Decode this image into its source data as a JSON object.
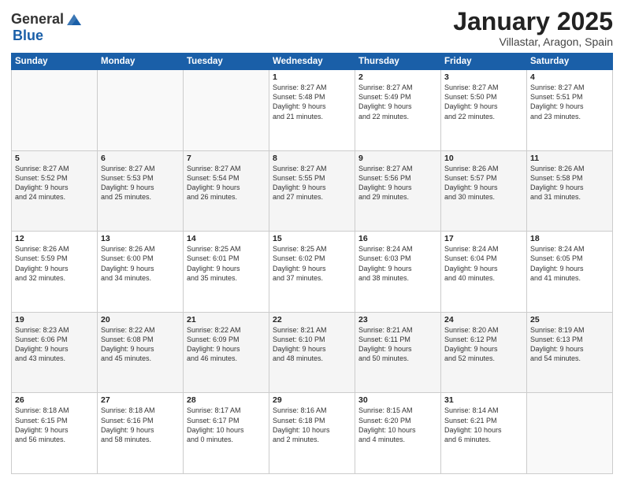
{
  "header": {
    "logo_general": "General",
    "logo_blue": "Blue",
    "month_title": "January 2025",
    "location": "Villastar, Aragon, Spain"
  },
  "weekdays": [
    "Sunday",
    "Monday",
    "Tuesday",
    "Wednesday",
    "Thursday",
    "Friday",
    "Saturday"
  ],
  "weeks": [
    [
      {
        "day": "",
        "info": ""
      },
      {
        "day": "",
        "info": ""
      },
      {
        "day": "",
        "info": ""
      },
      {
        "day": "1",
        "info": "Sunrise: 8:27 AM\nSunset: 5:48 PM\nDaylight: 9 hours\nand 21 minutes."
      },
      {
        "day": "2",
        "info": "Sunrise: 8:27 AM\nSunset: 5:49 PM\nDaylight: 9 hours\nand 22 minutes."
      },
      {
        "day": "3",
        "info": "Sunrise: 8:27 AM\nSunset: 5:50 PM\nDaylight: 9 hours\nand 22 minutes."
      },
      {
        "day": "4",
        "info": "Sunrise: 8:27 AM\nSunset: 5:51 PM\nDaylight: 9 hours\nand 23 minutes."
      }
    ],
    [
      {
        "day": "5",
        "info": "Sunrise: 8:27 AM\nSunset: 5:52 PM\nDaylight: 9 hours\nand 24 minutes."
      },
      {
        "day": "6",
        "info": "Sunrise: 8:27 AM\nSunset: 5:53 PM\nDaylight: 9 hours\nand 25 minutes."
      },
      {
        "day": "7",
        "info": "Sunrise: 8:27 AM\nSunset: 5:54 PM\nDaylight: 9 hours\nand 26 minutes."
      },
      {
        "day": "8",
        "info": "Sunrise: 8:27 AM\nSunset: 5:55 PM\nDaylight: 9 hours\nand 27 minutes."
      },
      {
        "day": "9",
        "info": "Sunrise: 8:27 AM\nSunset: 5:56 PM\nDaylight: 9 hours\nand 29 minutes."
      },
      {
        "day": "10",
        "info": "Sunrise: 8:26 AM\nSunset: 5:57 PM\nDaylight: 9 hours\nand 30 minutes."
      },
      {
        "day": "11",
        "info": "Sunrise: 8:26 AM\nSunset: 5:58 PM\nDaylight: 9 hours\nand 31 minutes."
      }
    ],
    [
      {
        "day": "12",
        "info": "Sunrise: 8:26 AM\nSunset: 5:59 PM\nDaylight: 9 hours\nand 32 minutes."
      },
      {
        "day": "13",
        "info": "Sunrise: 8:26 AM\nSunset: 6:00 PM\nDaylight: 9 hours\nand 34 minutes."
      },
      {
        "day": "14",
        "info": "Sunrise: 8:25 AM\nSunset: 6:01 PM\nDaylight: 9 hours\nand 35 minutes."
      },
      {
        "day": "15",
        "info": "Sunrise: 8:25 AM\nSunset: 6:02 PM\nDaylight: 9 hours\nand 37 minutes."
      },
      {
        "day": "16",
        "info": "Sunrise: 8:24 AM\nSunset: 6:03 PM\nDaylight: 9 hours\nand 38 minutes."
      },
      {
        "day": "17",
        "info": "Sunrise: 8:24 AM\nSunset: 6:04 PM\nDaylight: 9 hours\nand 40 minutes."
      },
      {
        "day": "18",
        "info": "Sunrise: 8:24 AM\nSunset: 6:05 PM\nDaylight: 9 hours\nand 41 minutes."
      }
    ],
    [
      {
        "day": "19",
        "info": "Sunrise: 8:23 AM\nSunset: 6:06 PM\nDaylight: 9 hours\nand 43 minutes."
      },
      {
        "day": "20",
        "info": "Sunrise: 8:22 AM\nSunset: 6:08 PM\nDaylight: 9 hours\nand 45 minutes."
      },
      {
        "day": "21",
        "info": "Sunrise: 8:22 AM\nSunset: 6:09 PM\nDaylight: 9 hours\nand 46 minutes."
      },
      {
        "day": "22",
        "info": "Sunrise: 8:21 AM\nSunset: 6:10 PM\nDaylight: 9 hours\nand 48 minutes."
      },
      {
        "day": "23",
        "info": "Sunrise: 8:21 AM\nSunset: 6:11 PM\nDaylight: 9 hours\nand 50 minutes."
      },
      {
        "day": "24",
        "info": "Sunrise: 8:20 AM\nSunset: 6:12 PM\nDaylight: 9 hours\nand 52 minutes."
      },
      {
        "day": "25",
        "info": "Sunrise: 8:19 AM\nSunset: 6:13 PM\nDaylight: 9 hours\nand 54 minutes."
      }
    ],
    [
      {
        "day": "26",
        "info": "Sunrise: 8:18 AM\nSunset: 6:15 PM\nDaylight: 9 hours\nand 56 minutes."
      },
      {
        "day": "27",
        "info": "Sunrise: 8:18 AM\nSunset: 6:16 PM\nDaylight: 9 hours\nand 58 minutes."
      },
      {
        "day": "28",
        "info": "Sunrise: 8:17 AM\nSunset: 6:17 PM\nDaylight: 10 hours\nand 0 minutes."
      },
      {
        "day": "29",
        "info": "Sunrise: 8:16 AM\nSunset: 6:18 PM\nDaylight: 10 hours\nand 2 minutes."
      },
      {
        "day": "30",
        "info": "Sunrise: 8:15 AM\nSunset: 6:20 PM\nDaylight: 10 hours\nand 4 minutes."
      },
      {
        "day": "31",
        "info": "Sunrise: 8:14 AM\nSunset: 6:21 PM\nDaylight: 10 hours\nand 6 minutes."
      },
      {
        "day": "",
        "info": ""
      }
    ]
  ]
}
